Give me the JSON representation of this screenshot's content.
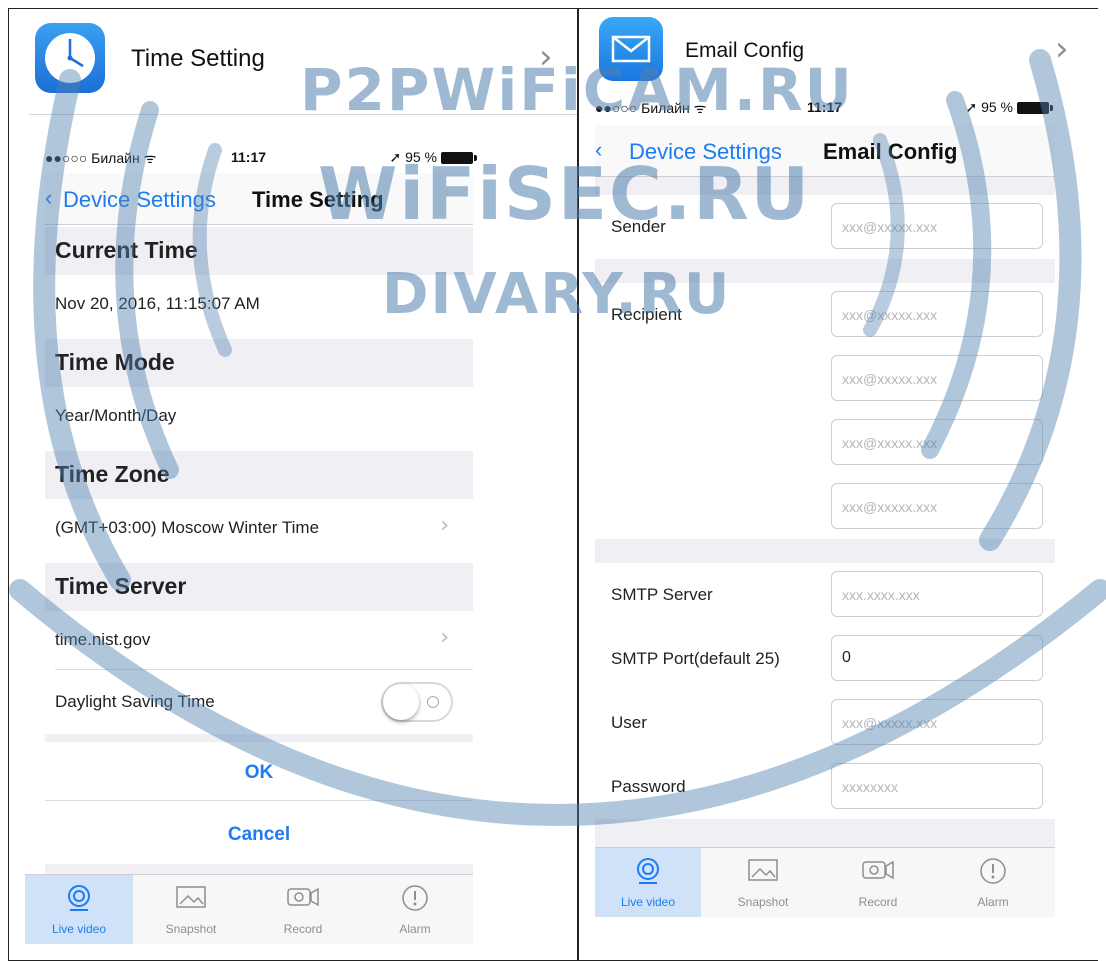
{
  "left": {
    "list_row": {
      "label": "Time Setting",
      "icon": "clock-icon"
    },
    "statusbar": {
      "carrier": "●●○○○ Билайн ᯤ",
      "time": "11:17",
      "battery": "➚ 95 %"
    },
    "navbar": {
      "back_label": "Device Settings",
      "title": "Time Setting"
    },
    "sections": {
      "current_time": {
        "header": "Current Time",
        "value": "Nov 20, 2016, 11:15:07 AM"
      },
      "time_mode": {
        "header": "Time Mode",
        "value": "Year/Month/Day"
      },
      "time_zone": {
        "header": "Time Zone",
        "value": "(GMT+03:00) Moscow Winter Time"
      },
      "time_server": {
        "header": "Time Server",
        "value": "time.nist.gov"
      },
      "dst": {
        "label": "Daylight Saving Time",
        "enabled": false
      }
    },
    "buttons": {
      "ok": "OK",
      "cancel": "Cancel"
    },
    "tabs": [
      {
        "label": "Live video",
        "icon": "live-video-icon",
        "active": true
      },
      {
        "label": "Snapshot",
        "icon": "snapshot-icon",
        "active": false
      },
      {
        "label": "Record",
        "icon": "record-icon",
        "active": false
      },
      {
        "label": "Alarm",
        "icon": "alarm-icon",
        "active": false
      }
    ]
  },
  "right": {
    "list_row": {
      "label": "Email Config",
      "icon": "envelope-icon"
    },
    "statusbar": {
      "carrier": "●●○○○ Билайн ᯤ",
      "time": "11:17",
      "battery": "➚ 95 %"
    },
    "navbar": {
      "back_label": "Device Settings",
      "title": "Email Config"
    },
    "fields": {
      "sender": {
        "label": "Sender",
        "placeholder": "xxx@xxxxx.xxx"
      },
      "recipient": {
        "label": "Recipient",
        "placeholders": [
          "xxx@xxxxx.xxx",
          "xxx@xxxxx.xxx",
          "xxx@xxxxx.xxx",
          "xxx@xxxxx.xxx"
        ]
      },
      "smtp_server": {
        "label": "SMTP Server",
        "placeholder": "xxx.xxxx.xxx"
      },
      "smtp_port": {
        "label": "SMTP Port(default 25)",
        "value": "0"
      },
      "user": {
        "label": "User",
        "placeholder": "xxx@xxxxx.xxx"
      },
      "password": {
        "label": "Password",
        "placeholder": "xxxxxxxx"
      }
    },
    "tabs": [
      {
        "label": "Live video",
        "icon": "live-video-icon",
        "active": true
      },
      {
        "label": "Snapshot",
        "icon": "snapshot-icon",
        "active": false
      },
      {
        "label": "Record",
        "icon": "record-icon",
        "active": false
      },
      {
        "label": "Alarm",
        "icon": "alarm-icon",
        "active": false
      }
    ]
  },
  "watermark": {
    "line1": "P2PWiFiCAM.RU",
    "line2": "WiFiSEC.RU",
    "line3": "DIVARY.RU"
  },
  "colors": {
    "accent": "#1e7cf0",
    "section_bg": "#efeff4",
    "active_tab_bg": "#cfe2f7",
    "watermark": "#5080af"
  }
}
